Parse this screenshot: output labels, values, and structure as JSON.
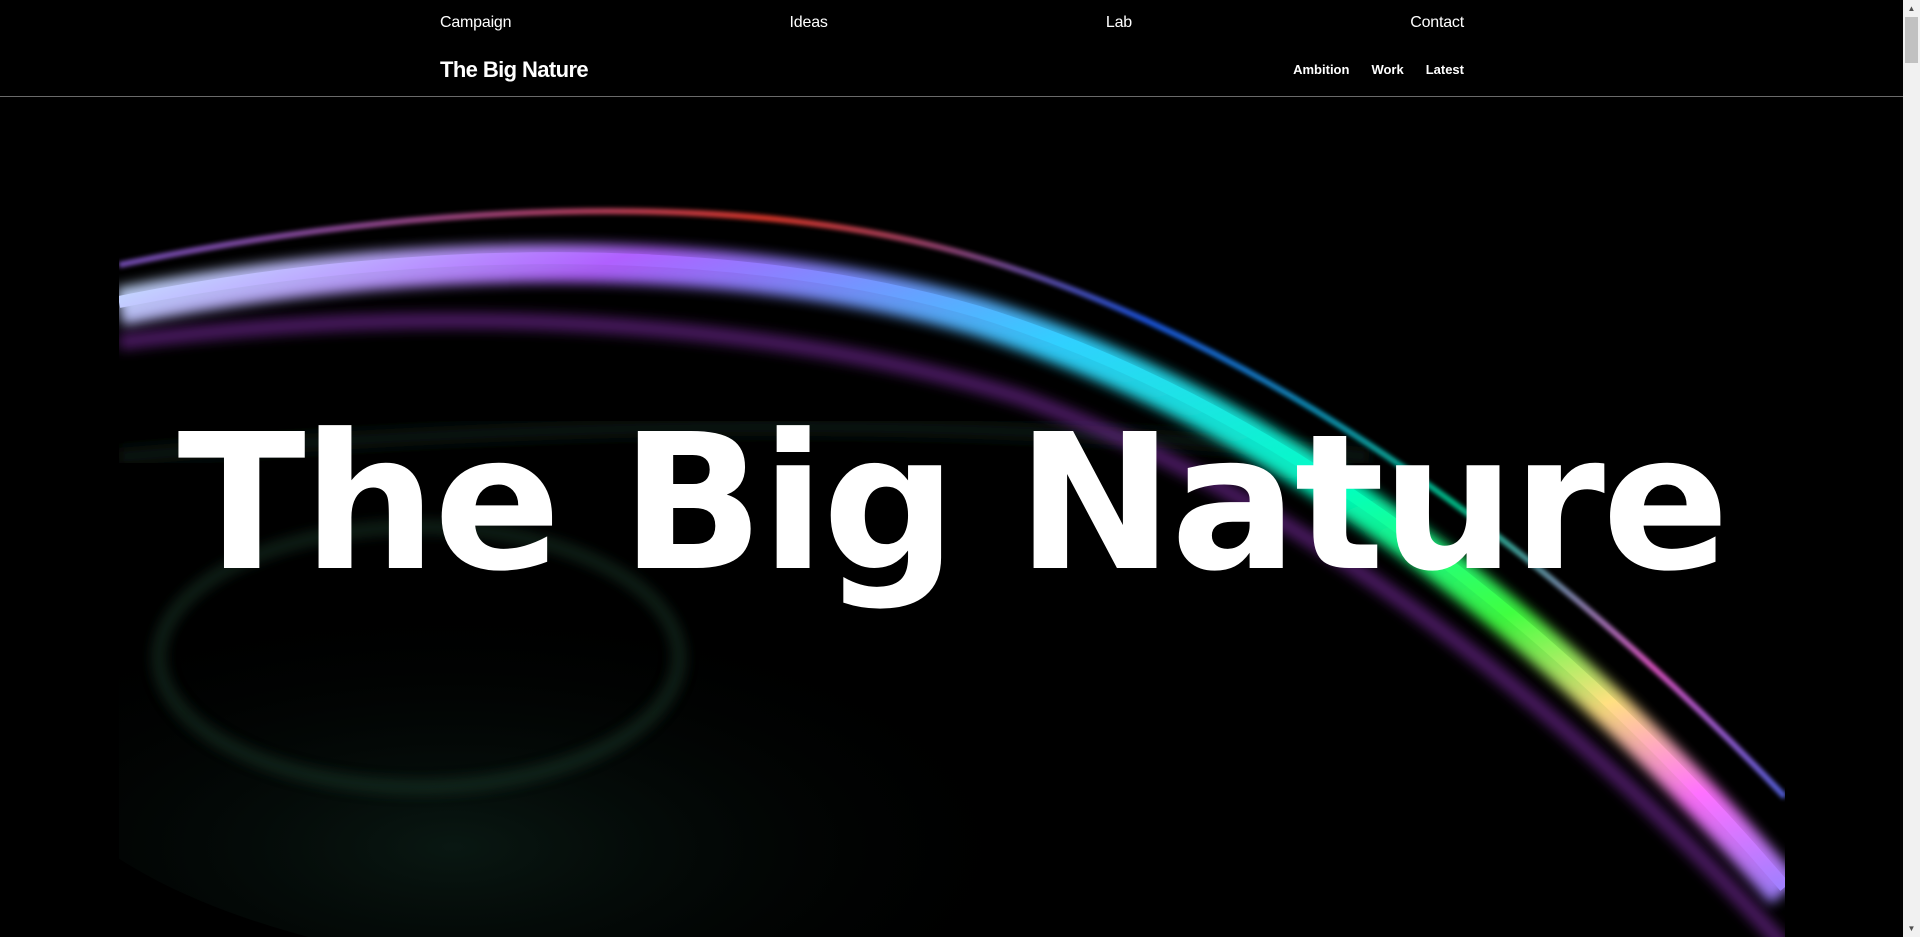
{
  "top_nav": {
    "items": [
      "Campaign",
      "Ideas",
      "Lab",
      "Contact"
    ]
  },
  "header": {
    "brand": "The Big Nature",
    "sub_nav": [
      "Ambition",
      "Work",
      "Latest"
    ]
  },
  "hero": {
    "title": "The Big Nature",
    "image": "iridescent-soap-bubble"
  },
  "colors": {
    "background": "#000000",
    "text": "#ffffff",
    "divider": "#6a6a6a"
  },
  "icons": {
    "scroll_up": "triangle-up-icon",
    "scroll_down": "triangle-down-icon"
  }
}
